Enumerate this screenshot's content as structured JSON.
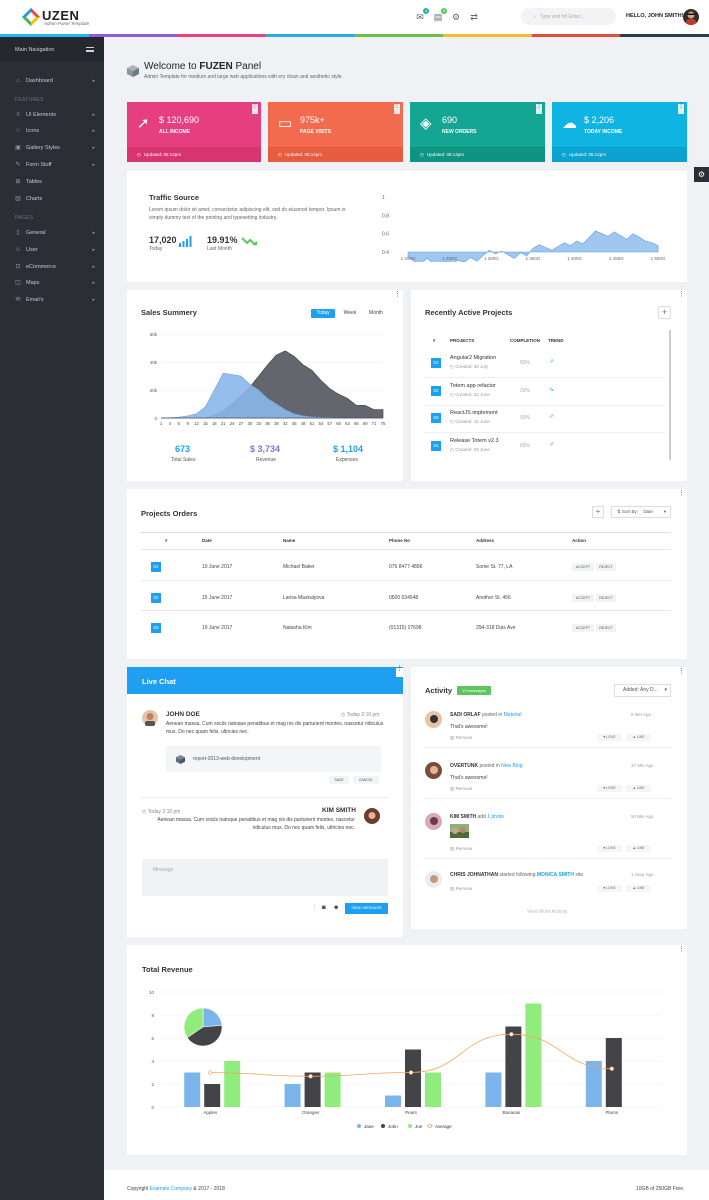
{
  "app": {
    "logo": "UZEN",
    "tagline": "Admin Panel Template"
  },
  "header": {
    "search_placeholder": "Type and hit Enter...",
    "badges": [
      "4",
      "5"
    ],
    "hello": "HELLO, JOHN SMITH!"
  },
  "colors": {
    "accent": "#1e9ff2",
    "sidebar": "#2b2e35",
    "stat1": "#e53f80",
    "stat2": "#f26b4e",
    "stat3": "#14a593",
    "stat4": "#0fb4e3",
    "green": "#5cc65c"
  },
  "sidebar": {
    "title": "Main Navigation",
    "dashboard": "Dashboard",
    "features_label": "FEATURES",
    "features": [
      "UI Elements",
      "Icons",
      "Gallery Styles",
      "Form Stuff",
      "Tables",
      "Charts"
    ],
    "pages_label": "PAGES",
    "pages": [
      "General",
      "User",
      "eCommerce",
      "Maps",
      "Email's"
    ]
  },
  "welcome": {
    "title_pre": "Welcome to ",
    "title_brand": "FUZEN",
    "title_post": " Panel",
    "subtitle": "Admin Template for medium and large web applications with ery clean and aesthetic style."
  },
  "stats": [
    {
      "value": "$ 120,690",
      "label": "ALL INCOME",
      "updated": "Updated: 05:14pm",
      "icon": "trending-up-icon"
    },
    {
      "value": "975k+",
      "label": "PAGE VISITS",
      "updated": "Updated: 05:14pm",
      "icon": "monitor-icon"
    },
    {
      "value": "690",
      "label": "NEW ORDERS",
      "updated": "Updated: 05:14pm",
      "icon": "cube-icon"
    },
    {
      "value": "$ 2,206",
      "label": "TODAY INCOME",
      "updated": "Updated: 05:14pm",
      "icon": "cloud-upload-icon"
    }
  ],
  "traffic": {
    "title": "Traffic Source",
    "desc": "Lorem ipsum dolor sit amet, consectetur adipiscing elit, sed do eiusmod tempor. Ipsum is simply dummy text of the printing and typesetting industry.",
    "today_value": "17,020",
    "today_label": "Today",
    "month_value": "19.91%",
    "month_label": "Last Month"
  },
  "sales": {
    "title": "Sales Summery",
    "tabs": [
      "Today",
      "Week",
      "Month"
    ],
    "summary": [
      {
        "value": "673",
        "label": "Total Sales"
      },
      {
        "value": "$ 3,734",
        "label": "Revenue"
      },
      {
        "value": "$ 1,104",
        "label": "Expenses"
      }
    ]
  },
  "projects": {
    "title": "Recently Active Projects",
    "headers": [
      "#",
      "PROJECTS",
      "COMPLETION",
      "TREND"
    ],
    "rows": [
      {
        "num": "01",
        "name": "Angular2 Migration",
        "created": "Created: 30 July",
        "completion": "80%"
      },
      {
        "num": "02",
        "name": "Totem app refactor",
        "created": "Created: 22 June",
        "completion": "29%"
      },
      {
        "num": "03",
        "name": "ReactJS implement",
        "created": "Created: 15 June",
        "completion": "59%"
      },
      {
        "num": "04",
        "name": "Release Totem v2.3",
        "created": "Created: 09 June",
        "completion": "65%"
      }
    ]
  },
  "orders": {
    "title": "Projects Orders",
    "sort_label": "Sort By:",
    "sort_value": "Date",
    "headers": [
      "#",
      "Date",
      "Name",
      "Phone No",
      "Address",
      "Action"
    ],
    "accept": "ACCEPT",
    "reject": "REJECT",
    "rows": [
      {
        "num": "01",
        "date": "10 June 2017",
        "name": "Michael Baker",
        "phone": "076 8477 4896",
        "address": "Some St. 77, LA"
      },
      {
        "num": "02",
        "date": "15 June 2017",
        "name": "Larisa Maskalyova",
        "phone": "0500 034548",
        "address": "Another St. 456"
      },
      {
        "num": "03",
        "date": "19 June 2017",
        "name": "Natasha Kim",
        "phone": "(01315) 27698",
        "address": "294-318 Duis Ave"
      }
    ]
  },
  "chat": {
    "title": "Live Chat",
    "msg1": {
      "name": "JOHN DOE",
      "time": "Today 2:10 pm",
      "text": "Aenean massa. Cum sociis natoque penatibus et mag nis dis parturient montes, nascetur ridiculus mus. Do nec quam felis, ultricies nec.",
      "file": "report-2013-web-development",
      "save": "SAVE",
      "cancel": "CANCEL"
    },
    "msg2": {
      "name": "KIM SMITH",
      "time": "Today 2:10 pm",
      "text": "Aenean massa. Cum sociis natoque penatibus et mag nis dis parturient montes, nascetur ridiculus mus. Do nec quam felis, ultricies nec."
    },
    "placeholder": "Message",
    "send": "SEND MESSAGE"
  },
  "activity": {
    "title": "Activity",
    "badge": "10 messages",
    "added_label": "Added:",
    "added_value": "Any D...",
    "items": [
      {
        "name": "SADI ORLAF",
        "action": "posted in",
        "link": "Material",
        "time": "5 Min Ago",
        "text": "That's awesome!"
      },
      {
        "name": "OVERTUNK",
        "action": "posted in",
        "link": "New Blog",
        "time": "37 Min Ago",
        "text": "That's awesome!"
      },
      {
        "name": "KIM SMITH",
        "action": "add",
        "link": "1 photo",
        "time": "50 Min Ago",
        "text": ""
      },
      {
        "name": "CHRIS JOHNATHAN",
        "action": "started following",
        "link": "MONICA SMITH",
        "action2": "site.",
        "time": "1 Hour Ago",
        "text": ""
      }
    ],
    "remove": "Remove",
    "love": "LOVE",
    "like": "LIKE",
    "view_more": "View More Activity"
  },
  "revenue": {
    "title": "Total Revenue"
  },
  "footer": {
    "pre": "Copyright ",
    "company": "Example Company",
    "post": " & 2017 - 2018",
    "storage": "10GB of 250GB Free."
  },
  "chart_data": [
    {
      "type": "area",
      "title": "",
      "x": [
        "1 200G",
        "1 250G",
        "1 300G",
        "1 350G",
        "1 400G",
        "1 450G",
        "1 500G"
      ],
      "ylim": [
        0,
        1
      ],
      "yticks": [
        "1",
        "0.8",
        "0.6",
        "0.4"
      ],
      "values": [
        0.35,
        0.3,
        0.26,
        0.33,
        0.28,
        0.24,
        0.3,
        0.27,
        0.31,
        0.29,
        0.34,
        0.3,
        0.36,
        0.42,
        0.38,
        0.41,
        0.37,
        0.33,
        0.39,
        0.36,
        0.44,
        0.48,
        0.45,
        0.42,
        0.46,
        0.5,
        0.47,
        0.52,
        0.49,
        0.56,
        0.63,
        0.6,
        0.57,
        0.62,
        0.58,
        0.54,
        0.6,
        0.56,
        0.52,
        0.5,
        0.47
      ]
    },
    {
      "type": "area",
      "title": "",
      "yticks": [
        "60k",
        "40k",
        "20k",
        "0"
      ],
      "x": [
        "1",
        "4",
        "5",
        "9",
        "12",
        "15",
        "18",
        "21",
        "24",
        "27",
        "30",
        "33",
        "36",
        "39",
        "42",
        "45",
        "48",
        "51",
        "54",
        "57",
        "60",
        "63",
        "66",
        "69",
        "71",
        "75"
      ],
      "series": [
        {
          "values": [
            0,
            0.2,
            0.6,
            1.5,
            3,
            8,
            20,
            32,
            31,
            30,
            24,
            20,
            14,
            10,
            6,
            3,
            1.5,
            0.8,
            0.4,
            0.2,
            0,
            0,
            0,
            0,
            0,
            0
          ]
        },
        {
          "values": [
            0,
            0,
            0,
            0,
            0,
            0,
            2,
            5,
            10,
            16,
            22,
            30,
            38,
            45,
            48,
            44,
            38,
            34,
            27,
            21,
            17,
            14,
            9,
            9,
            6,
            6
          ]
        }
      ]
    },
    {
      "type": "bar",
      "title": "",
      "categories": [
        "Apples",
        "Oranges",
        "Pears",
        "Bananas",
        "Plums"
      ],
      "ylim": [
        0,
        10
      ],
      "yticks": [
        0,
        2,
        4,
        6,
        8,
        10
      ],
      "series": [
        {
          "name": "Jane",
          "values": [
            3,
            2,
            1,
            3,
            4
          ],
          "color": "#7cb5ec"
        },
        {
          "name": "John",
          "values": [
            2,
            3,
            5,
            7,
            6
          ],
          "color": "#434348"
        },
        {
          "name": "Joe",
          "values": [
            4,
            3,
            3,
            9,
            0
          ],
          "color": "#90ed7d"
        },
        {
          "name": "Average",
          "type": "spline",
          "values": [
            3,
            2.67,
            3,
            6.33,
            3.33
          ],
          "color": "#f7a35c"
        }
      ],
      "pie": [
        {
          "value": 13,
          "color": "#7cb5ec"
        },
        {
          "value": 23,
          "color": "#434348"
        },
        {
          "value": 19,
          "color": "#90ed7d"
        }
      ]
    }
  ]
}
